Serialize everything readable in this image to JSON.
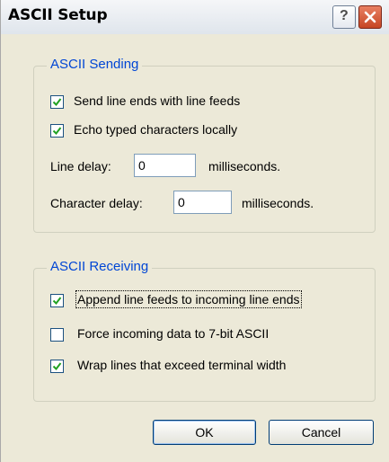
{
  "window": {
    "title": "ASCII Setup"
  },
  "sending": {
    "legend": "ASCII Sending",
    "send_line_ends": {
      "label": "Send line ends with line feeds",
      "checked": true
    },
    "echo_typed": {
      "label": "Echo typed characters locally",
      "checked": true
    },
    "line_delay": {
      "label": "Line delay:",
      "value": "0",
      "unit": "milliseconds."
    },
    "char_delay": {
      "label": "Character delay:",
      "value": "0",
      "unit": "milliseconds."
    }
  },
  "receiving": {
    "legend": "ASCII Receiving",
    "append_lf": {
      "label": "Append line feeds to incoming line ends",
      "checked": true
    },
    "force_7bit": {
      "label": "Force incoming data to 7-bit ASCII",
      "checked": false
    },
    "wrap_lines": {
      "label": "Wrap lines that exceed terminal width",
      "checked": true
    }
  },
  "buttons": {
    "ok": "OK",
    "cancel": "Cancel"
  }
}
